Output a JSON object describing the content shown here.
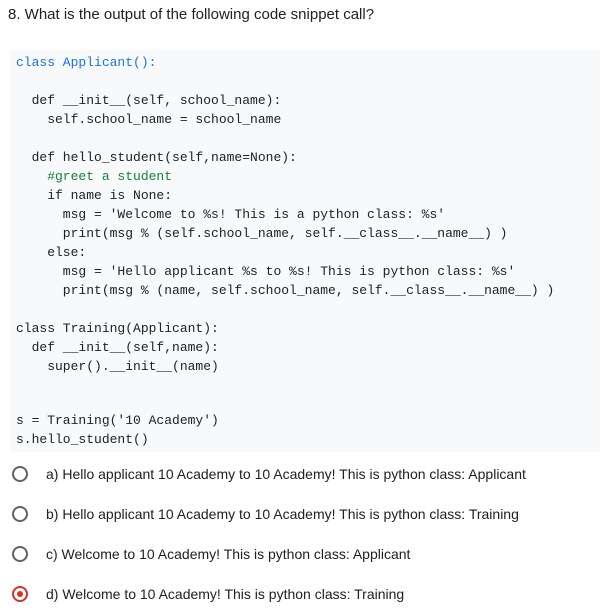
{
  "question": {
    "text": "8. What is the output of the following code snippet call?"
  },
  "code": {
    "lines": [
      "class Applicant():",
      "  def __init__(self, school_name):",
      "    self.school_name = school_name",
      "",
      "  def hello_student(self,name=None):",
      "    #greet a student",
      "    if name is None:",
      "      msg = 'Welcome to %s! This is a python class: %s'",
      "      print(msg % (self.school_name, self.__class__.__name__) )",
      "    else:",
      "      msg = 'Hello applicant %s to %s! This is python class: %s'",
      "      print(msg % (name, self.school_name, self.__class__.__name__) )",
      "",
      "class Training(Applicant):",
      "  def __init__(self,name):",
      "    super().__init__(name)",
      "",
      "",
      "s = Training('10 Academy')",
      "s.hello_student()"
    ]
  },
  "options": [
    {
      "label": "a) Hello applicant 10 Academy to 10 Academy! This is python class: Applicant",
      "selected": false
    },
    {
      "label": "b) Hello applicant 10 Academy to 10 Academy! This is python class: Training",
      "selected": false
    },
    {
      "label": "c) Welcome to 10 Academy! This is python class: Applicant",
      "selected": false
    },
    {
      "label": "d) Welcome to 10 Academy! This is python class: Training",
      "selected": true
    }
  ],
  "colors": {
    "code_background": "#f8f9fa",
    "keyword": "#1a73e8",
    "comment": "#188038",
    "string": "#c5221f",
    "selected_radio": "#d93025"
  }
}
